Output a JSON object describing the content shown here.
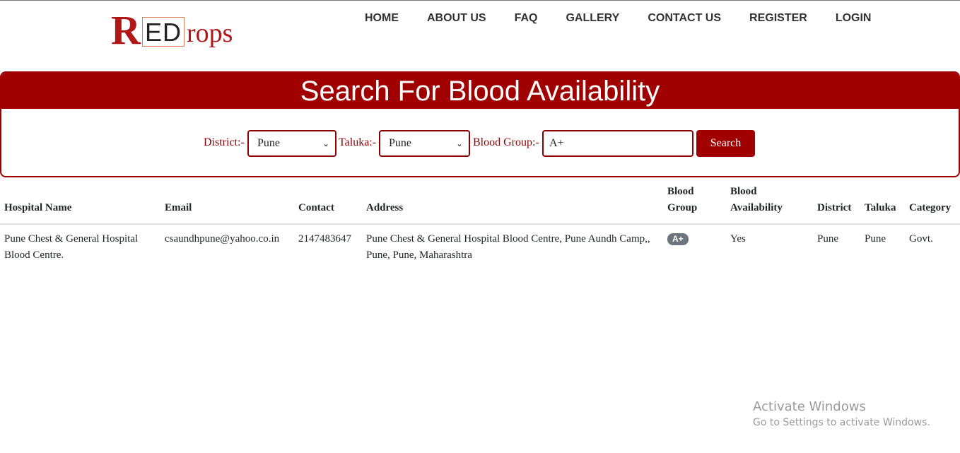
{
  "brand": {
    "logo_r": "R",
    "logo_ed": "ED",
    "logo_rops": "rops",
    "colors": {
      "primary": "#a00000",
      "logo_red": "#b01818",
      "logo_box": "#e07b5a"
    }
  },
  "nav": {
    "items": [
      {
        "label": "HOME"
      },
      {
        "label": "ABOUT US"
      },
      {
        "label": "FAQ"
      },
      {
        "label": "GALLERY"
      },
      {
        "label": "CONTACT US"
      },
      {
        "label": "REGISTER"
      },
      {
        "label": "LOGIN"
      }
    ]
  },
  "search": {
    "title": "Search For Blood Availability",
    "district_label": "District:-",
    "district_value": "Pune",
    "taluka_label": "Taluka:-",
    "taluka_value": "Pune",
    "blood_group_label": "Blood Group:-",
    "blood_group_value": "A+",
    "button_label": "Search"
  },
  "table": {
    "headers": {
      "hospital": "Hospital Name",
      "email": "Email",
      "contact": "Contact",
      "address": "Address",
      "blood_group": "Blood Group",
      "availability": "Blood Availability",
      "district": "District",
      "taluka": "Taluka",
      "category": "Category"
    },
    "rows": [
      {
        "hospital": "Pune Chest & General Hospital Blood Centre.",
        "email": "csaundhpune@yahoo.co.in",
        "contact": "2147483647",
        "address": "Pune Chest & General Hospital Blood Centre, Pune Aundh Camp,, Pune, Pune, Maharashtra",
        "blood_group": "A+",
        "availability": "Yes",
        "district": "Pune",
        "taluka": "Pune",
        "category": "Govt."
      }
    ]
  },
  "watermark": {
    "line1": "Activate Windows",
    "line2": "Go to Settings to activate Windows."
  }
}
